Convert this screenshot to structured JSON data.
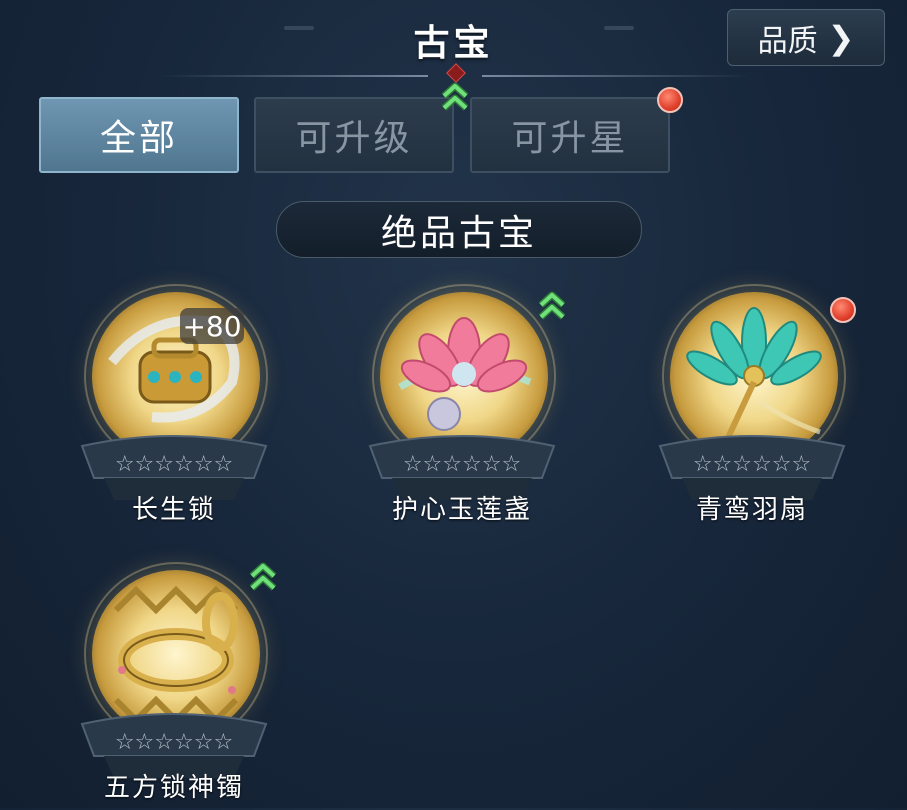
{
  "header": {
    "title": "古宝",
    "quality_label": "品质",
    "quality_chevron": "❯"
  },
  "tabs": [
    {
      "label": "全部",
      "active": true
    },
    {
      "label": "可升级",
      "active": false
    },
    {
      "label": "可升星",
      "active": false
    }
  ],
  "section": {
    "title": "绝品古宝"
  },
  "items": [
    {
      "name": "长生锁",
      "level": "+80",
      "stars": "☆☆☆☆☆☆",
      "max_stars": 6,
      "filled_stars": 0
    },
    {
      "name": "护心玉莲盏",
      "stars": "☆☆☆☆☆☆",
      "max_stars": 6,
      "filled_stars": 0
    },
    {
      "name": "青鸾羽扇",
      "stars": "☆☆☆☆☆☆",
      "max_stars": 6,
      "filled_stars": 0
    },
    {
      "name": "五方锁神镯",
      "stars": "☆☆☆☆☆☆",
      "max_stars": 6,
      "filled_stars": 0
    }
  ],
  "colors": {
    "upgrade_green": "#5fd46a",
    "notify_red": "#e0402c",
    "tab_active": "#5f87a2",
    "gold": "#e7c66c"
  }
}
